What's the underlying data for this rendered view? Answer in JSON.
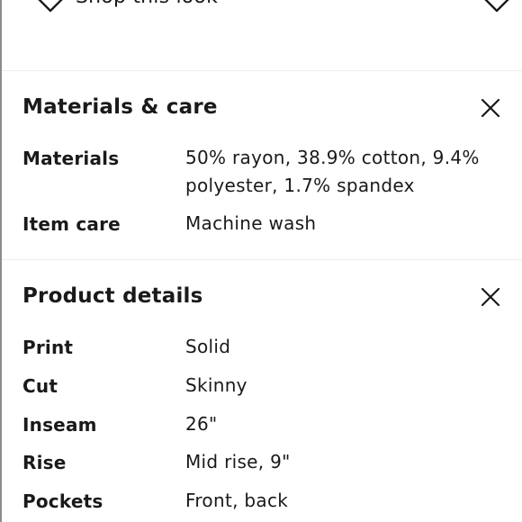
{
  "header": {
    "shop_label": "Shop this look"
  },
  "materials_care": {
    "title": "Materials & care",
    "rows": [
      {
        "label": "Materials",
        "value": "50% rayon, 38.9% cotton, 9.4% polyester, 1.7% spandex"
      },
      {
        "label": "Item care",
        "value": "Machine wash"
      }
    ]
  },
  "product_details": {
    "title": "Product details",
    "rows": [
      {
        "label": "Print",
        "value": "Solid"
      },
      {
        "label": "Cut",
        "value": "Skinny"
      },
      {
        "label": "Inseam",
        "value": "26\""
      },
      {
        "label": "Rise",
        "value": "Mid rise, 9\""
      },
      {
        "label": "Pockets",
        "value": "Front, back"
      }
    ]
  },
  "icons": {
    "tag": "tag-icon",
    "close": "close-icon"
  }
}
